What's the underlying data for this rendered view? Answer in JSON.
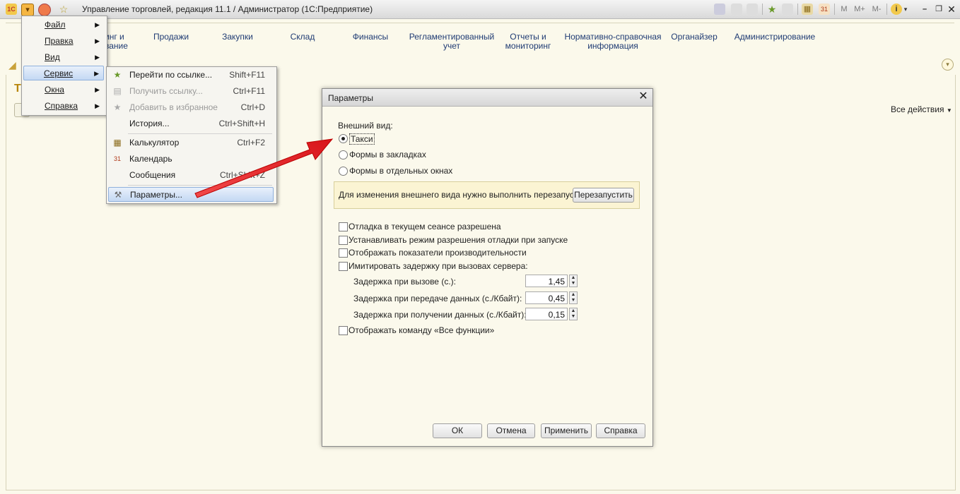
{
  "window": {
    "title": "Управление торговлей, редакция 11.1 / Администратор  (1С:Предприятие)"
  },
  "toolbar": {
    "m_label": "M",
    "mplus_label": "M+",
    "mminus_label": "M-"
  },
  "sections": [
    {
      "line1": "инг и",
      "line2": "вание"
    },
    {
      "line1": "Продажи",
      "line2": ""
    },
    {
      "line1": "Закупки",
      "line2": ""
    },
    {
      "line1": "Склад",
      "line2": ""
    },
    {
      "line1": "Финансы",
      "line2": ""
    },
    {
      "line1": "Регламентированный",
      "line2": "учет"
    },
    {
      "line1": "Отчеты и",
      "line2": "мониторинг"
    },
    {
      "line1": "Нормативно-справочная",
      "line2": "информация"
    },
    {
      "line1": "Органайзер",
      "line2": ""
    },
    {
      "line1": "Администрирование",
      "line2": ""
    }
  ],
  "page": {
    "title_fragment": "Т",
    "all_actions": "Все действия"
  },
  "main_menu": [
    {
      "label": "Файл"
    },
    {
      "label": "Правка"
    },
    {
      "label": "Вид"
    },
    {
      "label": "Сервис",
      "active": true
    },
    {
      "label": "Окна"
    },
    {
      "label": "Справка"
    }
  ],
  "service_menu": [
    {
      "label": "Перейти по ссылке...",
      "shortcut": "Shift+F11",
      "icon": "star-go-icon",
      "disabled": false
    },
    {
      "label": "Получить ссылку...",
      "shortcut": "Ctrl+F11",
      "icon": "link-icon",
      "disabled": true
    },
    {
      "label": "Добавить в избранное",
      "shortcut": "Ctrl+D",
      "icon": "star-add-icon",
      "disabled": true
    },
    {
      "label": "История...",
      "shortcut": "Ctrl+Shift+H",
      "icon": "",
      "disabled": false
    },
    {
      "label": "Калькулятор",
      "shortcut": "Ctrl+F2",
      "icon": "calculator-icon",
      "disabled": false
    },
    {
      "label": "Календарь",
      "shortcut": "",
      "icon": "calendar-icon",
      "disabled": false
    },
    {
      "label": "Сообщения",
      "shortcut": "Ctrl+Shift+Z",
      "icon": "",
      "disabled": false
    },
    {
      "label": "Параметры...",
      "shortcut": "",
      "icon": "wrench-icon",
      "disabled": false
    }
  ],
  "dialog": {
    "title": "Параметры",
    "appearance_label": "Внешний вид:",
    "radios": [
      {
        "label": "Такси",
        "checked": true
      },
      {
        "label": "Формы в закладках",
        "checked": false
      },
      {
        "label": "Формы в отдельных окнах",
        "checked": false
      }
    ],
    "notice": "Для изменения внешнего вида нужно выполнить перезапуск.",
    "restart_button": "Перезапустить",
    "checkboxes": [
      {
        "label": "Отладка в текущем сеансе разрешена",
        "checked": false
      },
      {
        "label": "Устанавливать режим разрешения отладки при запуске",
        "checked": false
      },
      {
        "label": "Отображать показатели производительности",
        "checked": false
      },
      {
        "label": "Имитировать задержку при вызовах сервера:",
        "checked": false
      }
    ],
    "delays": [
      {
        "label": "Задержка при вызове (с.):",
        "value": "1,45"
      },
      {
        "label": "Задержка при передаче данных (с./Кбайт):",
        "value": "0,45"
      },
      {
        "label": "Задержка при получении данных (с./Кбайт):",
        "value": "0,15"
      }
    ],
    "show_all_functions": {
      "label": "Отображать команду «Все функции»",
      "checked": false
    },
    "buttons": {
      "ok": "ОК",
      "cancel": "Отмена",
      "apply": "Применить",
      "help": "Справка"
    }
  },
  "colors": {
    "background": "#fbf9eb",
    "section_text": "#1f3b73",
    "arrow": "#e8262b"
  }
}
